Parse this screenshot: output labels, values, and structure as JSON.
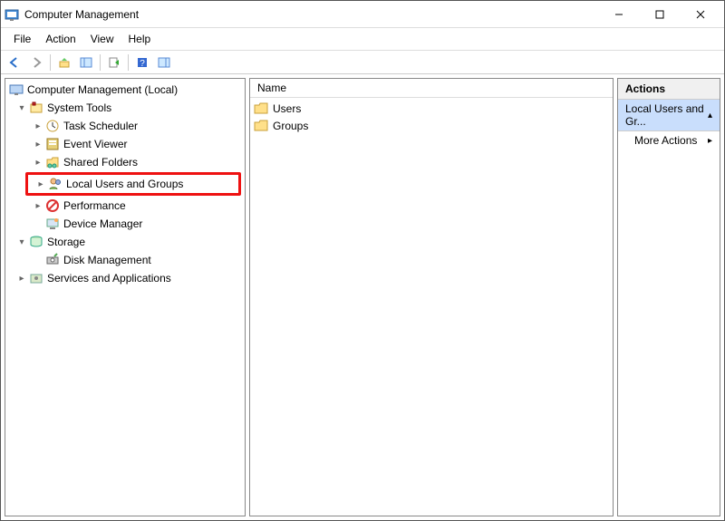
{
  "window": {
    "title": "Computer Management"
  },
  "menu": {
    "file": "File",
    "action": "Action",
    "view": "View",
    "help": "Help"
  },
  "tree": {
    "root": "Computer Management (Local)",
    "system_tools": "System Tools",
    "task_scheduler": "Task Scheduler",
    "event_viewer": "Event Viewer",
    "shared_folders": "Shared Folders",
    "local_users_groups": "Local Users and Groups",
    "performance": "Performance",
    "device_manager": "Device Manager",
    "storage": "Storage",
    "disk_management": "Disk Management",
    "services_apps": "Services and Applications"
  },
  "list": {
    "header_name": "Name",
    "items": {
      "0": "Users",
      "1": "Groups"
    }
  },
  "actions": {
    "header": "Actions",
    "selected": "Local Users and Gr...",
    "more": "More Actions"
  }
}
